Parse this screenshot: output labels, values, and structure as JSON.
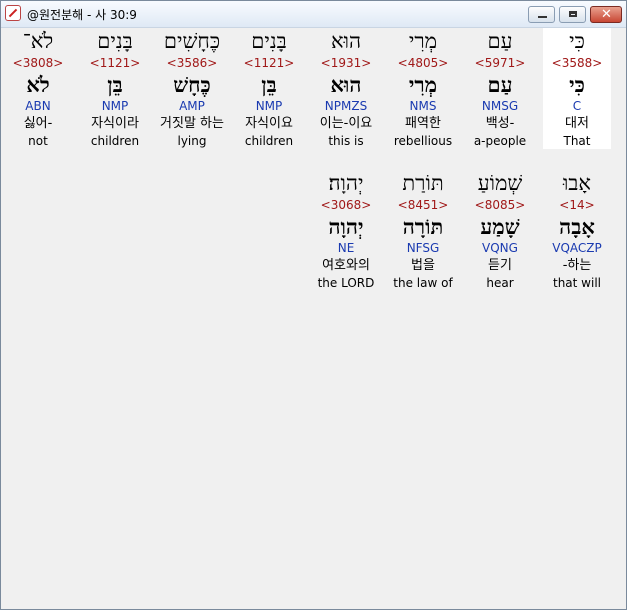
{
  "window": {
    "title": "@원전분해 - 사 30:9",
    "icon": "app-logo-icon",
    "controls": {
      "minimize": "minimize-icon",
      "maximize": "maximize-icon",
      "close": "close-icon"
    }
  },
  "words": [
    {
      "hebrew": "כִּי",
      "strong": "<3588>",
      "lemma": "כִּי",
      "morph": "C",
      "korean": "대저",
      "english": "That",
      "selected": true
    },
    {
      "hebrew": "עַם",
      "strong": "<5971>",
      "lemma": "עַם",
      "morph": "NMSG",
      "korean": "백성-",
      "english": "a-people"
    },
    {
      "hebrew": "מְרִי",
      "strong": "<4805>",
      "lemma": "מְרִי",
      "morph": "NMS",
      "korean": "패역한",
      "english": "rebellious"
    },
    {
      "hebrew": "הוּא",
      "strong": "<1931>",
      "lemma": "הוּא",
      "morph": "NPMZS",
      "korean": "이는-이요",
      "english": "this is"
    },
    {
      "hebrew": "בָּנִים",
      "strong": "<1121>",
      "lemma": "בֵּן",
      "morph": "NMP",
      "korean": "자식이요",
      "english": "children"
    },
    {
      "hebrew": "כֶּחָשִׁים",
      "strong": "<3586>",
      "lemma": "כֶּחָשׁ",
      "morph": "AMP",
      "korean": "거짓말 하는",
      "english": "lying"
    },
    {
      "hebrew": "בָּנִים",
      "strong": "<1121>",
      "lemma": "בֵּן",
      "morph": "NMP",
      "korean": "자식이라",
      "english": "children"
    },
    {
      "hebrew": "לֹא־",
      "strong": "<3808>",
      "lemma": "לֹא",
      "morph": "ABN",
      "korean": "싫어-",
      "english": "not"
    },
    {
      "hebrew": "אָבוּ",
      "strong": "<14>",
      "lemma": "אָבָה",
      "morph": "VQACZP",
      "korean": "-하는",
      "english": "that will"
    },
    {
      "hebrew": "שְׁמוֹעַ",
      "strong": "<8085>",
      "lemma": "שָׁמַע",
      "morph": "VQNG",
      "korean": "듣기",
      "english": "hear"
    },
    {
      "hebrew": "תּוֹרַת",
      "strong": "<8451>",
      "lemma": "תּוֹרָה",
      "morph": "NFSG",
      "korean": "법을",
      "english": "the law of"
    },
    {
      "hebrew": "יְהוָה׃",
      "strong": "<3068>",
      "lemma": "יְהוָה",
      "morph": "NE",
      "korean": "여호와의",
      "english": "the LORD"
    }
  ]
}
